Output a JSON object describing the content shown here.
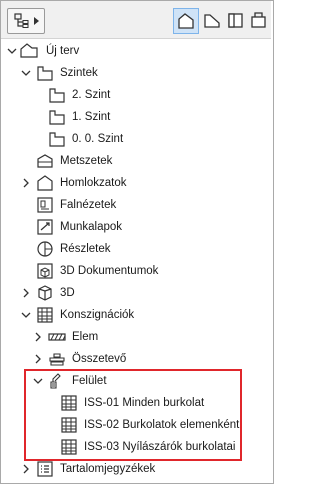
{
  "toolbar": {
    "dropdown_icon": "tree-settings-icon",
    "views": [
      {
        "icon": "project-map-icon",
        "active": true
      },
      {
        "icon": "view-map-icon",
        "active": false
      },
      {
        "icon": "layout-book-icon",
        "active": false
      },
      {
        "icon": "publisher-sets-icon",
        "active": false
      }
    ]
  },
  "tree": {
    "root": "Új terv",
    "stories_folder": "Szintek",
    "stories": [
      "2. Szint",
      "1. Szint",
      "0. 0. Szint"
    ],
    "sections": "Metszetek",
    "elevations": "Homlokzatok",
    "interior_elevations": "Falnézetek",
    "worksheets": "Munkalapok",
    "details": "Részletek",
    "documents_3d": "3D Dokumentumok",
    "view_3d": "3D",
    "schedules": "Konszignációk",
    "schedule_element": "Elem",
    "schedule_component": "Összetevő",
    "schedule_surface": "Felület",
    "surface_items": [
      "ISS-01 Minden burkolat",
      "ISS-02 Burkolatok elemenként",
      "ISS-03 Nyílászárók burkolatai"
    ],
    "toc": "Tartalomjegyzékek"
  },
  "colors": {
    "highlight": "#e0262b",
    "active_view_bg": "#cfe3f7",
    "active_view_border": "#7eb4ea"
  }
}
